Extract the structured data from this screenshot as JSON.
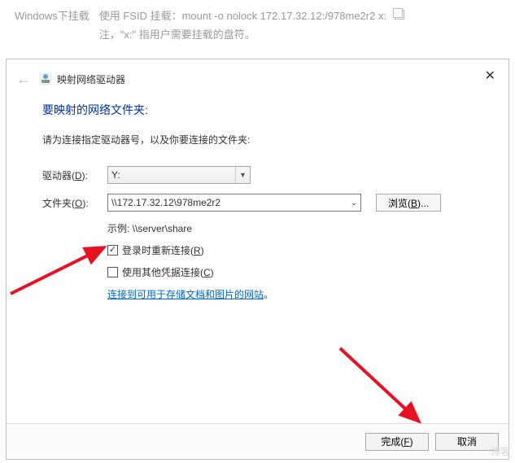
{
  "top": {
    "label": "Windows下挂载",
    "line1": "使用 FSID 挂载：mount -o nolock 172.17.32.12:/978me2r2 x:",
    "line2": "注，\"x:\" 指用户需要挂载的盘符。"
  },
  "dialog": {
    "title": "映射网络驱动器",
    "close": "✕",
    "heading": "要映射的网络文件夹:",
    "instruction": "请为连接指定驱动器号，以及你要连接的文件夹:",
    "drive_label": "驱动器(D):",
    "drive_value": "Y:",
    "folder_label": "文件夹(O):",
    "folder_value": "\\\\172.17.32.12\\978me2r2",
    "browse": "浏览(B)...",
    "example": "示例: \\\\server\\share",
    "reconnect": "登录时重新连接(R)",
    "other_creds": "使用其他凭据连接(C)",
    "link": "连接到可用于存储文档和图片的网站",
    "link_suffix": "。",
    "finish": "完成(F)",
    "cancel": "取消"
  },
  "watermark": "博客"
}
